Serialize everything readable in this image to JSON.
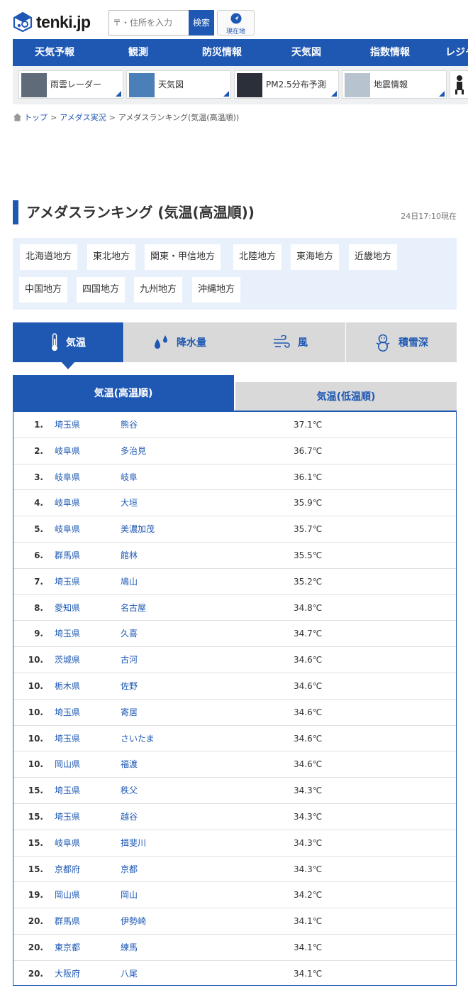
{
  "header": {
    "logo_text": "tenki.jp",
    "search_placeholder": "〒・住所を入力",
    "search_button": "検索",
    "location_button": "現在地"
  },
  "nav": [
    "天気予報",
    "観測",
    "防災情報",
    "天気図",
    "指数情報",
    "レジャー"
  ],
  "quick_links": [
    "雨雲レーダー",
    "天気図",
    "PM2.5分布予測",
    "地震情報"
  ],
  "breadcrumb": [
    "トップ",
    "アメダス実況",
    "アメダスランキング(気温(高温順))"
  ],
  "page_title": "アメダスランキング (気温(高温順))",
  "timestamp": "24日17:10現在",
  "regions": [
    "北海道地方",
    "東北地方",
    "関東・甲信地方",
    "北陸地方",
    "東海地方",
    "近畿地方",
    "中国地方",
    "四国地方",
    "九州地方",
    "沖縄地方"
  ],
  "category_tabs": [
    "気温",
    "降水量",
    "風",
    "積雪深"
  ],
  "sub_tabs": [
    "気温(高温順)",
    "気温(低温順)"
  ],
  "ranking": [
    {
      "rank": "1.",
      "pref": "埼玉県",
      "city": "熊谷",
      "temp": "37.1℃"
    },
    {
      "rank": "2.",
      "pref": "岐阜県",
      "city": "多治見",
      "temp": "36.7℃"
    },
    {
      "rank": "3.",
      "pref": "岐阜県",
      "city": "岐阜",
      "temp": "36.1℃"
    },
    {
      "rank": "4.",
      "pref": "岐阜県",
      "city": "大垣",
      "temp": "35.9℃"
    },
    {
      "rank": "5.",
      "pref": "岐阜県",
      "city": "美濃加茂",
      "temp": "35.7℃"
    },
    {
      "rank": "6.",
      "pref": "群馬県",
      "city": "館林",
      "temp": "35.5℃"
    },
    {
      "rank": "7.",
      "pref": "埼玉県",
      "city": "鳩山",
      "temp": "35.2℃"
    },
    {
      "rank": "8.",
      "pref": "愛知県",
      "city": "名古屋",
      "temp": "34.8℃"
    },
    {
      "rank": "9.",
      "pref": "埼玉県",
      "city": "久喜",
      "temp": "34.7℃"
    },
    {
      "rank": "10.",
      "pref": "茨城県",
      "city": "古河",
      "temp": "34.6℃"
    },
    {
      "rank": "10.",
      "pref": "栃木県",
      "city": "佐野",
      "temp": "34.6℃"
    },
    {
      "rank": "10.",
      "pref": "埼玉県",
      "city": "寄居",
      "temp": "34.6℃"
    },
    {
      "rank": "10.",
      "pref": "埼玉県",
      "city": "さいたま",
      "temp": "34.6℃"
    },
    {
      "rank": "10.",
      "pref": "岡山県",
      "city": "福渡",
      "temp": "34.6℃"
    },
    {
      "rank": "15.",
      "pref": "埼玉県",
      "city": "秩父",
      "temp": "34.3℃"
    },
    {
      "rank": "15.",
      "pref": "埼玉県",
      "city": "越谷",
      "temp": "34.3℃"
    },
    {
      "rank": "15.",
      "pref": "岐阜県",
      "city": "揖斐川",
      "temp": "34.3℃"
    },
    {
      "rank": "15.",
      "pref": "京都府",
      "city": "京都",
      "temp": "34.3℃"
    },
    {
      "rank": "19.",
      "pref": "岡山県",
      "city": "岡山",
      "temp": "34.2℃"
    },
    {
      "rank": "20.",
      "pref": "群馬県",
      "city": "伊勢崎",
      "temp": "34.1℃"
    },
    {
      "rank": "20.",
      "pref": "東京都",
      "city": "練馬",
      "temp": "34.1℃"
    },
    {
      "rank": "20.",
      "pref": "大阪府",
      "city": "八尾",
      "temp": "34.1℃"
    }
  ],
  "colors": {
    "brand": "#1e58b3",
    "tab_inactive": "#d9d9d9",
    "region_bg": "#e8f1fb"
  }
}
